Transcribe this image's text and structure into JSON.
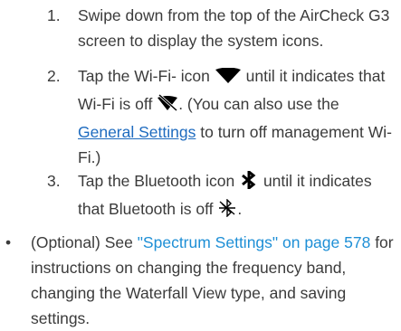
{
  "steps": [
    {
      "number": "1.",
      "text": "Swipe down from the top of the AirCheck G3 screen to display the system icons."
    },
    {
      "number": "2.",
      "before_icon": "Tap the Wi-Fi- icon",
      "icon_on": "wifi-on-icon",
      "between_icons": "until it indicates that Wi-Fi is off",
      "icon_off": "wifi-off-icon",
      "after_icon": ". (You can also use the",
      "link_text": "General Settings",
      "after_link": "to turn off management Wi-Fi.)"
    },
    {
      "number": "3.",
      "before_icon": "Tap the Bluetooth icon",
      "icon_on": "bluetooth-on-icon",
      "between_icons": "until it indicates that Bluetooth is off",
      "icon_off": "bluetooth-off-icon",
      "after_icon": "."
    }
  ],
  "bullet": {
    "marker": "•",
    "prefix": "(Optional) See",
    "link_text": "\"Spectrum Settings\" on page 578",
    "suffix": "for instructions on changing the frequency band, changing the Waterfall View type, and saving settings."
  },
  "colors": {
    "text": "#3b3b3b",
    "link_underlined": "#1e6bbf",
    "link_plain": "#1e8fd6",
    "icon": "#000000"
  }
}
